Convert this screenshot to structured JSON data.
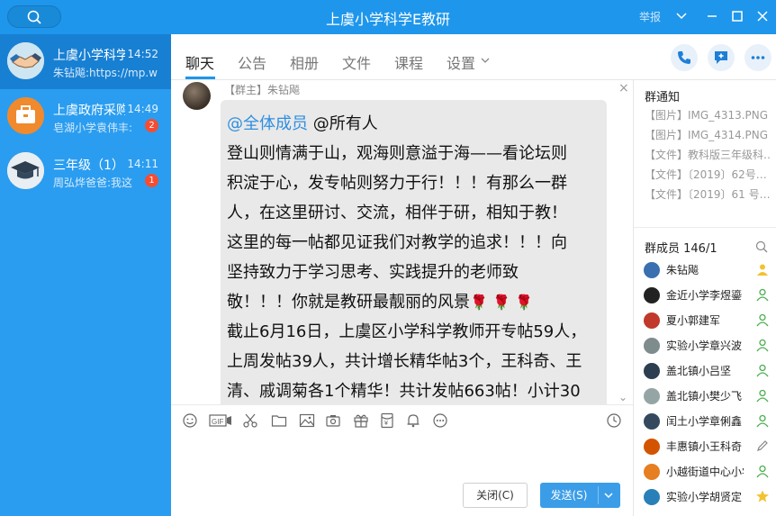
{
  "window": {
    "title": "上虞小学科学E教研",
    "report_label": "举报"
  },
  "conversations": [
    {
      "name": "上虞小学科学",
      "time": "14:52",
      "preview": "朱钻飚:https://mp.w",
      "badge": "",
      "active": true
    },
    {
      "name": "上虞政府采购",
      "time": "14:49",
      "preview": "皂湖小学袁伟丰:",
      "badge": "2",
      "active": false
    },
    {
      "name": "三年级（1）",
      "time": "14:11",
      "preview": "周弘烨爸爸:我这",
      "badge": "1",
      "active": false
    }
  ],
  "tabs": [
    {
      "label": "聊天",
      "active": true
    },
    {
      "label": "公告"
    },
    {
      "label": "相册"
    },
    {
      "label": "文件"
    },
    {
      "label": "课程"
    },
    {
      "label": "设置"
    }
  ],
  "message": {
    "sender": "【群主】朱钻飚",
    "mention": "@全体成员",
    "lines": [
      "@所有人",
      "登山则情满于山，观海则意溢于海——看论坛则",
      "积淀于心，发专帖则努力于行！！！有那么一群",
      "人，在这里研讨、交流，相伴于研，相知于教！",
      "这里的每一帖都见证我们对教学的追求！！！向",
      "坚持致力于学习思考、实践提升的老师致",
      "敬！！！你就是教研最靓丽的风景",
      "截止6月16日，上虞区小学科学教师开专帖59人，",
      "上周发帖39人，共计增长精华帖3个，王科奇、王",
      "清、戚调菊各1个精华！共计发帖663帖！小计30"
    ],
    "roses": "🌹 🌹 🌹"
  },
  "buttons": {
    "close": "关闭(C)",
    "send": "发送(S)"
  },
  "notices": {
    "title": "群通知",
    "items": [
      "【图片】IMG_4313.PNG",
      "【图片】IMG_4314.PNG",
      "【文件】教科版三年级科…",
      "【文件】〔2019〕62号…",
      "【文件】〔2019〕61 号…"
    ]
  },
  "members": {
    "title": "群成员 146/1",
    "list": [
      {
        "name": "朱钻飚",
        "color": "#3a6fb0",
        "role": "owner"
      },
      {
        "name": "金近小学李煜鎏",
        "color": "#222222",
        "role": "admin"
      },
      {
        "name": "夏小郭建军",
        "color": "#c0392b",
        "role": "admin"
      },
      {
        "name": "实验小学章兴波",
        "color": "#7f8c8d",
        "role": "admin"
      },
      {
        "name": "盖北镇小吕坚",
        "color": "#2c3e50",
        "role": "admin"
      },
      {
        "name": "盖北镇小樊少飞",
        "color": "#95a5a6",
        "role": "admin"
      },
      {
        "name": "闰土小学章俐鑫",
        "color": "#34495e",
        "role": "admin"
      },
      {
        "name": "丰惠镇小王科奇",
        "color": "#d35400",
        "role": "edit"
      },
      {
        "name": "小越街道中心小学章",
        "color": "#e67e22",
        "role": "admin"
      },
      {
        "name": "实验小学胡贤定",
        "color": "#2980b9",
        "role": "star"
      }
    ]
  }
}
